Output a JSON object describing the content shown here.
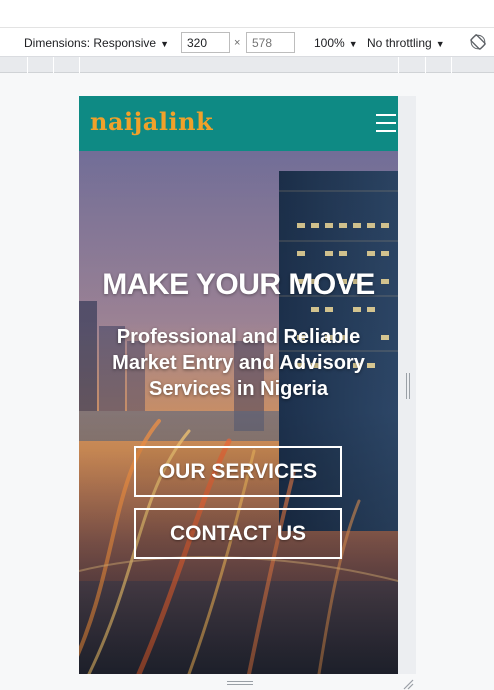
{
  "toolbar": {
    "dimensions_label": "Dimensions: Responsive",
    "dropdown_arrow": "▼",
    "width_value": "320",
    "times_symbol": "×",
    "height_placeholder": "578",
    "zoom_label": "100%",
    "throttle_label": "No throttling",
    "rotate_icon": "rotate-icon"
  },
  "site": {
    "logo_text": "naijalink",
    "menu_icon": "hamburger-menu-icon",
    "headline": "MAKE YOUR MOVE",
    "subheadline": "Professional and Reliable Market Entry and Advisory Services in Nigeria",
    "primary_button": "OUR SERVICES",
    "secondary_button": "CONTACT US"
  },
  "colors": {
    "nav_background": "#0e8a84",
    "logo_color": "#f0a12a",
    "button_border": "#ffffff"
  }
}
